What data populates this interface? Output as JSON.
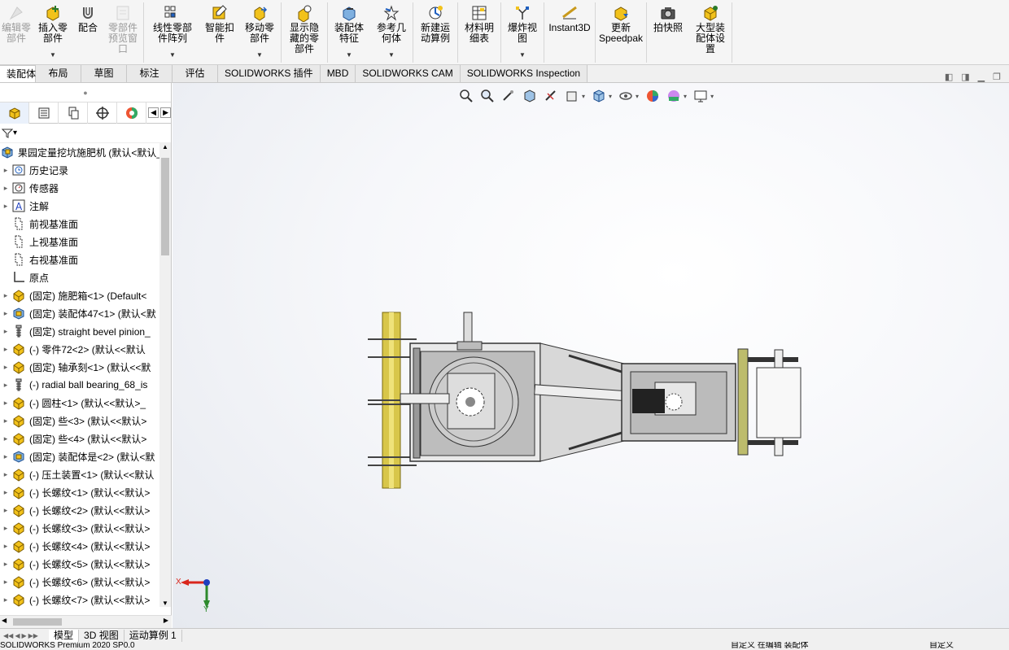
{
  "ribbon": {
    "buttons": [
      {
        "label": "编辑零\n部件",
        "disabled": true,
        "dropdown": false
      },
      {
        "label": "插入零\n部件",
        "disabled": false,
        "dropdown": true
      },
      {
        "label": "配合",
        "disabled": false,
        "dropdown": false
      },
      {
        "label": "零部件\n预览窗\n口",
        "disabled": true,
        "dropdown": false
      },
      {
        "label": "线性零部\n件阵列",
        "disabled": false,
        "dropdown": true
      },
      {
        "label": "智能扣\n件",
        "disabled": false,
        "dropdown": false
      },
      {
        "label": "移动零\n部件",
        "disabled": false,
        "dropdown": true
      },
      {
        "label": "显示隐\n藏的零\n部件",
        "disabled": false,
        "dropdown": false
      },
      {
        "label": "装配体\n特征",
        "disabled": false,
        "dropdown": true
      },
      {
        "label": "参考几\n何体",
        "disabled": false,
        "dropdown": true
      },
      {
        "label": "新建运\n动算例",
        "disabled": false,
        "dropdown": false
      },
      {
        "label": "材料明\n细表",
        "disabled": false,
        "dropdown": false
      },
      {
        "label": "爆炸视\n图",
        "disabled": false,
        "dropdown": true
      },
      {
        "label": "Instant3D",
        "disabled": false,
        "dropdown": false
      },
      {
        "label": "更新\nSpeedpak",
        "disabled": false,
        "dropdown": false
      },
      {
        "label": "拍快照",
        "disabled": false,
        "dropdown": false
      },
      {
        "label": "大型装\n配体设\n置",
        "disabled": false,
        "dropdown": false
      }
    ]
  },
  "tabs": [
    "装配体",
    "布局",
    "草图",
    "标注",
    "评估",
    "SOLIDWORKS 插件",
    "MBD",
    "SOLIDWORKS CAM",
    "SOLIDWORKS Inspection"
  ],
  "active_tab": "装配体",
  "tree": {
    "root": "果园定量挖坑施肥机 (默认<默认_",
    "items": [
      {
        "label": "历史记录",
        "icon": "history-icon"
      },
      {
        "label": "传感器",
        "icon": "sensor-icon"
      },
      {
        "label": "注解",
        "icon": "annotation-icon"
      },
      {
        "label": "前视基准面",
        "icon": "plane-icon"
      },
      {
        "label": "上视基准面",
        "icon": "plane-icon"
      },
      {
        "label": "右视基准面",
        "icon": "plane-icon"
      },
      {
        "label": "原点",
        "icon": "origin-icon"
      },
      {
        "label": "(固定) 施肥箱<1> (Default<",
        "icon": "part-icon"
      },
      {
        "label": "(固定) 装配体47<1> (默认<默",
        "icon": "assembly-icon"
      },
      {
        "label": "(固定) straight bevel pinion_",
        "icon": "toolbox-icon"
      },
      {
        "label": "(-) 零件72<2> (默认<<默认",
        "icon": "part-icon"
      },
      {
        "label": "(固定) 轴承刻<1> (默认<<默",
        "icon": "part-icon"
      },
      {
        "label": "(-) radial ball bearing_68_is",
        "icon": "toolbox-icon"
      },
      {
        "label": "(-) 圆柱<1> (默认<<默认>_",
        "icon": "part-icon"
      },
      {
        "label": "(固定) 些<3> (默认<<默认>",
        "icon": "part-icon"
      },
      {
        "label": "(固定) 些<4> (默认<<默认>",
        "icon": "part-icon"
      },
      {
        "label": "(固定) 装配体是<2> (默认<默",
        "icon": "assembly-icon"
      },
      {
        "label": "(-) 压土装置<1> (默认<<默认",
        "icon": "part-icon"
      },
      {
        "label": "(-) 长螺纹<1> (默认<<默认>",
        "icon": "part-icon"
      },
      {
        "label": "(-) 长螺纹<2> (默认<<默认>",
        "icon": "part-icon"
      },
      {
        "label": "(-) 长螺纹<3> (默认<<默认>",
        "icon": "part-icon"
      },
      {
        "label": "(-) 长螺纹<4> (默认<<默认>",
        "icon": "part-icon"
      },
      {
        "label": "(-) 长螺纹<5> (默认<<默认>",
        "icon": "part-icon"
      },
      {
        "label": "(-) 长螺纹<6> (默认<<默认>",
        "icon": "part-icon"
      },
      {
        "label": "(-) 长螺纹<7> (默认<<默认>",
        "icon": "part-icon"
      }
    ]
  },
  "triad": {
    "x_label": "X",
    "y_label": "Y"
  },
  "bottom_tabs": [
    "模型",
    "3D 视图",
    "运动算例 1"
  ],
  "active_bottom_tab": "模型",
  "status": {
    "left": "SOLIDWORKS Premium 2020 SP0.0",
    "mid": "自定义    在编辑 装配体",
    "right": "自定义"
  },
  "colors": {
    "accent": "#1f5fbf",
    "part_yellow": "#f2c21b",
    "triad_x": "#d9261c",
    "triad_y": "#2d8a2d",
    "triad_z": "#1f3fbf"
  }
}
